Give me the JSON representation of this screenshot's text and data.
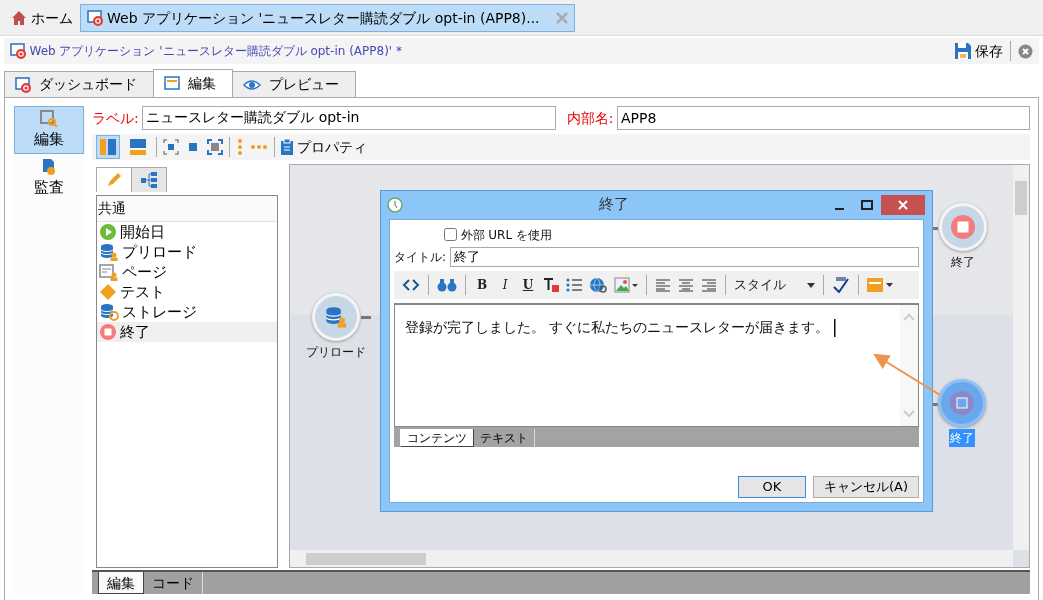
{
  "tabs": [
    {
      "label": "ホーム",
      "kind": "home",
      "selected": false
    },
    {
      "label": "Web アプリケーション 'ニュースレター購読ダブル opt-in (APP8)...",
      "kind": "document",
      "selected": true
    }
  ],
  "document": {
    "title": "Web アプリケーション 'ニュースレター購読ダブル opt-in (APP8)' *",
    "save_label": "保存"
  },
  "view_tabs": [
    {
      "label": "ダッシュボード",
      "kind": "dashboard",
      "selected": false
    },
    {
      "label": "編集",
      "kind": "edit",
      "selected": true
    },
    {
      "label": "プレビュー",
      "kind": "preview",
      "selected": false
    }
  ],
  "sidebar": [
    {
      "label": "編集",
      "kind": "edit",
      "selected": true
    },
    {
      "label": "監査",
      "kind": "audit",
      "selected": false
    }
  ],
  "label_field": {
    "label": "ラベル:",
    "value": "ニュースレター購読ダブル opt-in"
  },
  "internal_name_field": {
    "label": "内部名:",
    "value": "APP8"
  },
  "toolbar": {
    "layouts": [
      {
        "kind": "vertical",
        "selected": true
      },
      {
        "kind": "horizontal",
        "selected": false
      }
    ],
    "properties_label": "プロパティ"
  },
  "palette": {
    "tabs": [
      {
        "kind": "pencil",
        "selected": true
      },
      {
        "kind": "tree",
        "selected": false
      }
    ],
    "group": "共通",
    "items": [
      {
        "label": "開始日",
        "kind": "start",
        "selected": false
      },
      {
        "label": "プリロード",
        "kind": "preload",
        "selected": false
      },
      {
        "label": "ページ",
        "kind": "page",
        "selected": false
      },
      {
        "label": "テスト",
        "kind": "test",
        "selected": false
      },
      {
        "label": "ストレージ",
        "kind": "storage",
        "selected": false
      },
      {
        "label": "終了",
        "kind": "end",
        "selected": true
      }
    ]
  },
  "canvas": {
    "nodes": [
      {
        "label": "プリロード",
        "kind": "preload",
        "selected": false
      },
      {
        "label": "終了",
        "kind": "end",
        "selected": false
      },
      {
        "label": "終了",
        "kind": "end",
        "selected": true
      }
    ]
  },
  "dialog": {
    "title": "終了",
    "external_url": {
      "label": "外部 URL を使用",
      "checked": false
    },
    "title_field": {
      "label": "タイトル:",
      "value": "終了"
    },
    "format_buttons": [
      "B",
      "I",
      "U"
    ],
    "style_label": "スタイル",
    "content": "登録が完了しました。 すぐに私たちのニュースレターが届きます。",
    "editor_tabs": [
      {
        "label": "コンテンツ",
        "selected": true
      },
      {
        "label": "テキスト",
        "selected": false
      }
    ],
    "buttons": [
      "OK",
      "キャンセル(A)"
    ]
  },
  "bottom_tabs": [
    {
      "label": "編集",
      "selected": true
    },
    {
      "label": "コード",
      "selected": false
    }
  ]
}
